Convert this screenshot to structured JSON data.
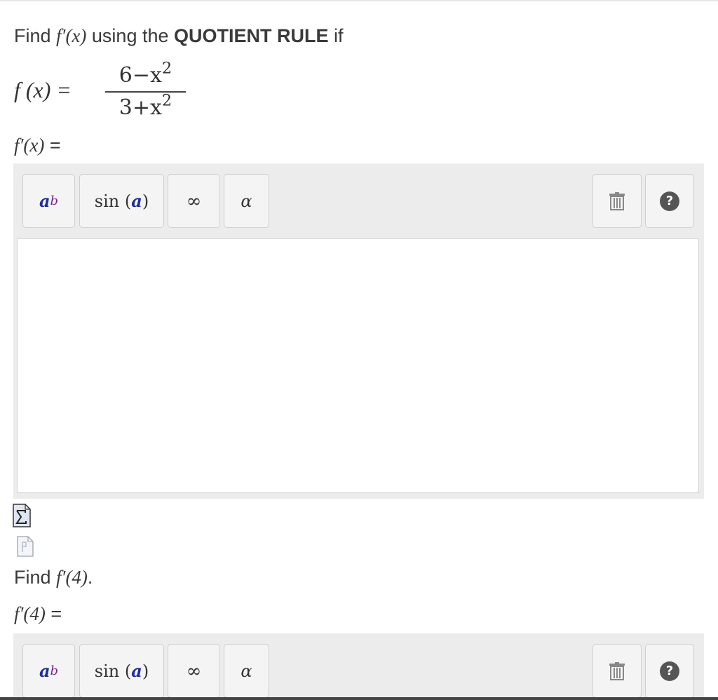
{
  "question1": {
    "prefix": "Find ",
    "func": "f′(x)",
    "middle": " using the ",
    "emphasis": "QUOTIENT RULE",
    "suffix": " if"
  },
  "formula": {
    "lhs": "f (x) =",
    "numerator": "6−x",
    "denominator": "3+x",
    "exponent": "2"
  },
  "answer1_label": {
    "func": "f′(x)",
    "eq": " ="
  },
  "toolbar": {
    "power_base": "a",
    "power_exp": "b",
    "sin_label": "sin (",
    "sin_arg": "a",
    "sin_close": ")",
    "infinity": "∞",
    "alpha": "α",
    "help": "?"
  },
  "question2": {
    "prefix": "Find ",
    "func": "f′(4)",
    "suffix": "."
  },
  "answer2_label": {
    "func": "f′(4)",
    "eq": " ="
  },
  "icons": {
    "sigma": "sigma-preview-icon",
    "doc": "document-icon",
    "trash": "trash-icon",
    "help": "help-icon"
  },
  "colors": {
    "toolbar_bg": "#ececec",
    "button_bg": "#f4f4f4",
    "power_base": "#1f2d9e",
    "power_exp": "#7b2a8b"
  }
}
